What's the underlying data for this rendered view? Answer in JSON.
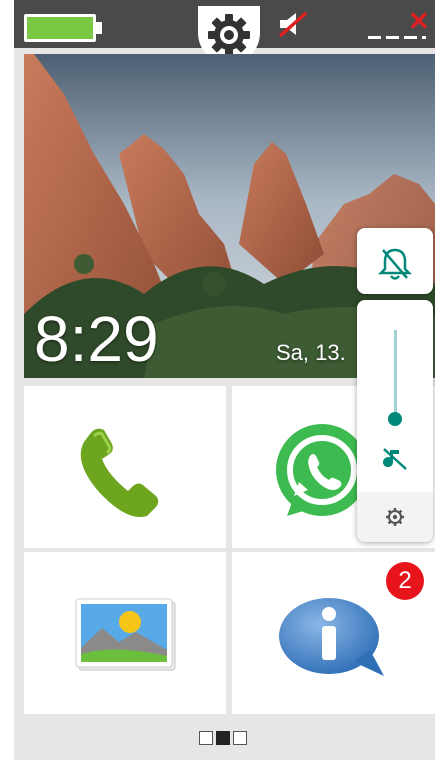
{
  "status_bar": {
    "battery_icon": "battery-full-icon",
    "center_icon": "gear-icon",
    "muted_icon": "speaker-off-icon",
    "close_icon": "close-icon",
    "close_label": "✕",
    "colors": {
      "bar": "#4a4a4a",
      "battery": "#7ac943",
      "close": "#e02020"
    }
  },
  "lock": {
    "time": "8:29",
    "date": "Sa, 13."
  },
  "apps": [
    {
      "icon": "phone-icon"
    },
    {
      "icon": "whatsapp-icon"
    },
    {
      "icon": "gallery-icon"
    },
    {
      "icon": "info-icon",
      "badge": "2"
    }
  ],
  "pager": {
    "pages": 3,
    "current": 2
  },
  "volume": {
    "ringer_icon": "bell-off-icon",
    "media_icon": "music-off-icon",
    "settings_icon": "settings-icon",
    "accent": "#00897b",
    "level": 0
  }
}
